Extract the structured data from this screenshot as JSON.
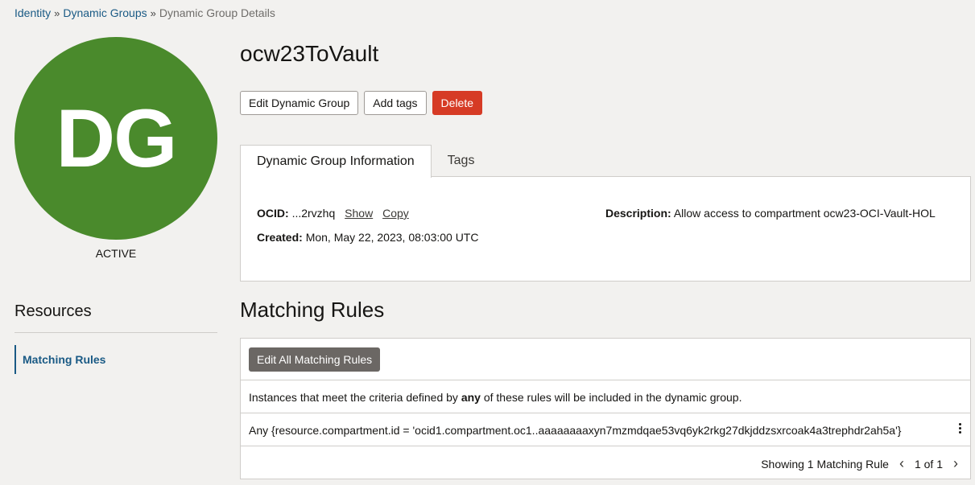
{
  "breadcrumb": {
    "items": [
      "Identity",
      "Dynamic Groups",
      "Dynamic Group Details"
    ],
    "separator": "»"
  },
  "avatar": {
    "initials": "DG",
    "color": "#4a8a2c",
    "status": "ACTIVE"
  },
  "sidebar": {
    "title": "Resources",
    "items": [
      {
        "label": "Matching Rules",
        "active": true
      }
    ]
  },
  "page": {
    "title": "ocw23ToVault",
    "actions": {
      "edit": "Edit Dynamic Group",
      "add_tags": "Add tags",
      "delete": "Delete"
    },
    "tabs": [
      "Dynamic Group Information",
      "Tags"
    ],
    "active_tab": 0
  },
  "info": {
    "ocid_label": "OCID:",
    "ocid_value": "...2rvzhq",
    "show_label": "Show",
    "copy_label": "Copy",
    "created_label": "Created:",
    "created_value": "Mon, May 22, 2023, 08:03:00 UTC",
    "description_label": "Description:",
    "description_value": "Allow access to compartment ocw23-OCI-Vault-HOL"
  },
  "rules": {
    "title": "Matching Rules",
    "edit_button": "Edit All Matching Rules",
    "criteria_prefix": "Instances that meet the criteria defined by ",
    "criteria_emphasis": "any",
    "criteria_suffix": " of these rules will be included in the dynamic group.",
    "rule_text": "Any {resource.compartment.id = 'ocid1.compartment.oc1..aaaaaaaaxyn7mzmdqae53vq6yk2rkg27dkjddzsxrcoak4a3trephdr2ah5a'}",
    "footer_text": "Showing 1 Matching Rule",
    "page_info": "1 of 1"
  },
  "colors": {
    "link": "#1a5a85",
    "danger": "#d63b25",
    "dark_button": "#6b6764"
  }
}
